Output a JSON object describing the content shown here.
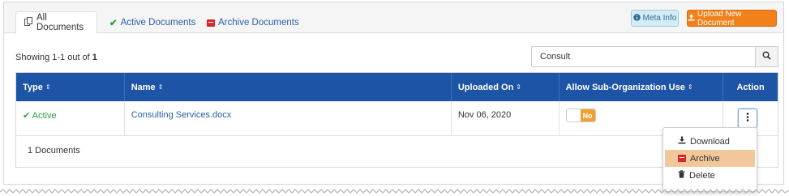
{
  "tabs": [
    {
      "label": "All Documents",
      "icon": "documents-icon",
      "active": true
    },
    {
      "label": "Active Documents",
      "icon": "check-icon",
      "active": false
    },
    {
      "label": "Archive Documents",
      "icon": "archive-box-icon",
      "active": false
    }
  ],
  "toolbar": {
    "meta_info_label": "Meta Info",
    "upload_label": "Upload New Document"
  },
  "summary": {
    "showing_prefix": "Showing 1-1 out of ",
    "showing_total": "1"
  },
  "search": {
    "value": "Consult",
    "placeholder": ""
  },
  "table": {
    "columns": [
      "Type",
      "Name",
      "Uploaded On",
      "Allow Sub-Organization Use",
      "Action"
    ],
    "rows": [
      {
        "type": "Active",
        "name": "Consulting Services.docx",
        "uploaded_on": "Nov 06, 2020",
        "allow_sub_org": "No"
      }
    ],
    "footer": "1 Documents"
  },
  "action_menu": {
    "items": [
      {
        "label": "Download",
        "icon": "download-icon"
      },
      {
        "label": "Archive",
        "icon": "archive-box-icon",
        "highlighted": true
      },
      {
        "label": "Delete",
        "icon": "trash-icon"
      }
    ]
  },
  "colors": {
    "header_blue": "#1d54a6",
    "upload_orange": "#f0811b",
    "active_green": "#2e9e3e",
    "archive_red": "#d9262c",
    "menu_highlight": "#f2c79c"
  }
}
